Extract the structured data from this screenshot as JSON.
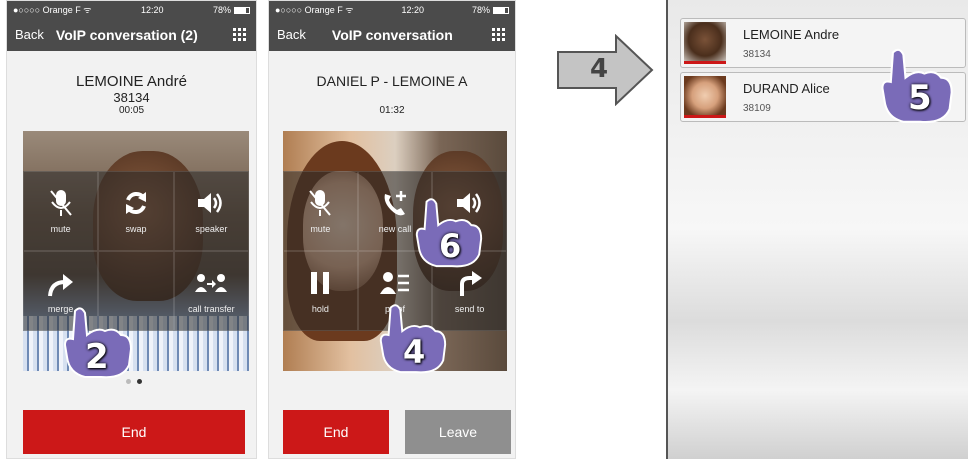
{
  "screen1": {
    "status": {
      "carrier": "●○○○○ Orange F ᯤ",
      "time": "12:20",
      "battery": "78%"
    },
    "nav": {
      "back": "Back",
      "title": "VoIP conversation (2)"
    },
    "caller": {
      "name": "LEMOINE André",
      "number": "38134",
      "duration": "00:05"
    },
    "controls": [
      {
        "icon": "microphone-off",
        "label": "mute"
      },
      {
        "icon": "swap",
        "label": "swap"
      },
      {
        "icon": "speaker",
        "label": "speaker"
      },
      {
        "icon": "merge",
        "label": "merge"
      },
      {
        "icon": "empty",
        "label": ""
      },
      {
        "icon": "call-transfer",
        "label": "call transfer"
      }
    ],
    "end_label": "End",
    "step": "2"
  },
  "screen2": {
    "status": {
      "carrier": "●○○○○ Orange F ᯤ",
      "time": "12:20",
      "battery": "78%"
    },
    "nav": {
      "back": "Back",
      "title": "VoIP conversation"
    },
    "caller": {
      "name": "DANIEL P - LEMOINE A",
      "duration": "01:32"
    },
    "controls": [
      {
        "icon": "microphone-off",
        "label": "mute"
      },
      {
        "icon": "new-call",
        "label": "new call"
      },
      {
        "icon": "speaker",
        "label": "ker"
      },
      {
        "icon": "hold",
        "label": "hold"
      },
      {
        "icon": "participants",
        "label": "pa   of"
      },
      {
        "icon": "send-to",
        "label": "send to"
      }
    ],
    "end_label": "End",
    "leave_label": "Leave",
    "step_a": "6",
    "step_b": "4"
  },
  "arrow_step": "4",
  "contacts": {
    "items": [
      {
        "name": "LEMOINE Andre",
        "number": "38134"
      },
      {
        "name": "DURAND Alice",
        "number": "38109"
      }
    ],
    "step": "5"
  },
  "colors": {
    "end": "#cc1818",
    "navbar": "#4b4b4b",
    "leave": "#8f8f8f"
  }
}
